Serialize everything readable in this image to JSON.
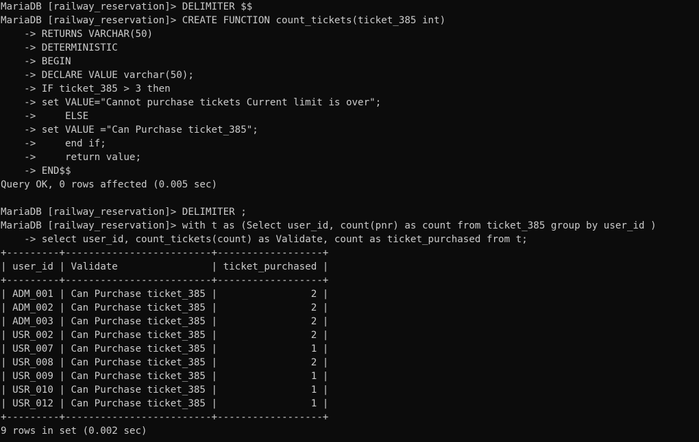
{
  "terminal": {
    "background": "#0c0c0c",
    "foreground": "#cccccc",
    "lines": [
      "MariaDB [railway_reservation]> DELIMITER $$",
      "MariaDB [railway_reservation]> CREATE FUNCTION count_tickets(ticket_385 int)",
      "    -> RETURNS VARCHAR(50)",
      "    -> DETERMINISTIC",
      "    -> BEGIN",
      "    -> DECLARE VALUE varchar(50);",
      "    -> IF ticket_385 > 3 then",
      "    -> set VALUE=\"Cannot purchase tickets Current limit is over\";",
      "    ->     ELSE",
      "    -> set VALUE =\"Can Purchase ticket_385\";",
      "    ->     end if;",
      "    ->     return value;",
      "    -> END$$",
      "Query OK, 0 rows affected (0.005 sec)",
      "",
      "MariaDB [railway_reservation]> DELIMITER ;",
      "MariaDB [railway_reservation]> with t as (Select user_id, count(pnr) as count from ticket_385 group by user_id )",
      "    -> select user_id, count_tickets(count) as Validate, count as ticket_purchased from t;",
      "+---------+-------------------------+------------------+",
      "| user_id | Validate                | ticket_purchased |",
      "+---------+-------------------------+------------------+",
      "| ADM_001 | Can Purchase ticket_385 |                2 |",
      "| ADM_002 | Can Purchase ticket_385 |                2 |",
      "| ADM_003 | Can Purchase ticket_385 |                2 |",
      "| USR_002 | Can Purchase ticket_385 |                2 |",
      "| USR_007 | Can Purchase ticket_385 |                1 |",
      "| USR_008 | Can Purchase ticket_385 |                2 |",
      "| USR_009 | Can Purchase ticket_385 |                1 |",
      "| USR_010 | Can Purchase ticket_385 |                1 |",
      "| USR_012 | Can Purchase ticket_385 |                1 |",
      "+---------+-------------------------+------------------+",
      "9 rows in set (0.002 sec)"
    ]
  }
}
